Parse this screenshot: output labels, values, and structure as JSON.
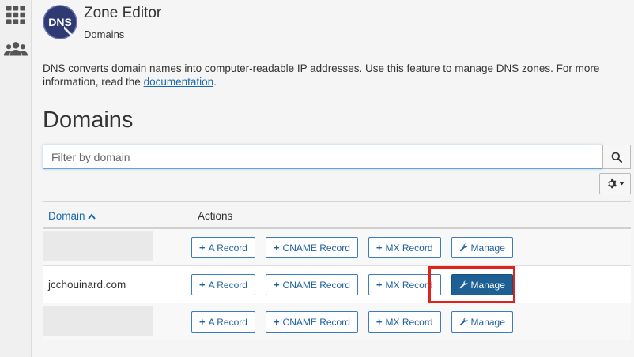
{
  "rail": {
    "icons": [
      "grid-icon",
      "users-icon"
    ]
  },
  "header": {
    "logo_text": "DNS",
    "title": "Zone Editor",
    "subtitle": "Domains"
  },
  "intro": {
    "text_before": "DNS converts domain names into computer-readable IP addresses. Use this feature to manage DNS zones. For more information, read the ",
    "link": "documentation",
    "text_after": "."
  },
  "page_heading": "Domains",
  "filter": {
    "placeholder": "Filter by domain"
  },
  "table": {
    "col_domain": "Domain",
    "col_actions": "Actions",
    "rows": [
      {
        "domain": "",
        "a": "A Record",
        "cname": "CNAME Record",
        "mx": "MX Record",
        "manage": "Manage"
      },
      {
        "domain": "jcchouinard.com",
        "a": "A Record",
        "cname": "CNAME Record",
        "mx": "MX Record",
        "manage": "Manage"
      },
      {
        "domain": "",
        "a": "A Record",
        "cname": "CNAME Record",
        "mx": "MX Record",
        "manage": "Manage"
      }
    ]
  },
  "colors": {
    "link": "#1a6ab0",
    "primary": "#1e5f94",
    "highlight": "#e0221c"
  }
}
